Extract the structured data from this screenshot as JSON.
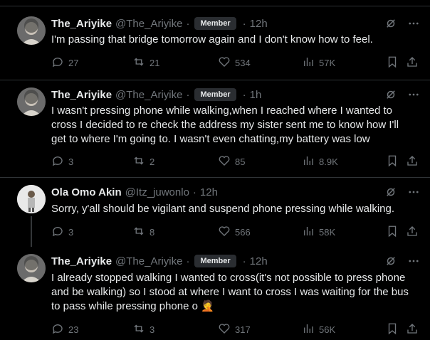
{
  "posts": [
    {
      "name": "The_Ariyike",
      "handle": "@The_Ariyike",
      "badge": "Member",
      "time": "12h",
      "lines": [
        "I'm passing that bridge tomorrow again and I don't know how to feel."
      ],
      "replies": "27",
      "reposts": "21",
      "likes": "534",
      "views": "57K"
    },
    {
      "name": "The_Ariyike",
      "handle": "@The_Ariyike",
      "badge": "Member",
      "time": "1h",
      "lines": [
        "I wasn't pressing phone while walking,when I reached where I wanted to",
        "cross I decided to re check the address my sister sent me to know how I'll",
        "get to where I'm going to. I wasn't even chatting,my battery was low"
      ],
      "replies": "3",
      "reposts": "2",
      "likes": "85",
      "views": "8.9K"
    },
    {
      "name": "Ola Omo Akin",
      "handle": "@Itz_juwonlo",
      "badge": "",
      "time": "12h",
      "lines": [
        "Sorry, y'all should be vigilant and suspend phone pressing while walking."
      ],
      "replies": "3",
      "reposts": "8",
      "likes": "566",
      "views": "58K"
    },
    {
      "name": "The_Ariyike",
      "handle": "@The_Ariyike",
      "badge": "Member",
      "time": "12h",
      "lines": [
        "I already stopped walking I wanted to cross(it's not possible to press phone",
        "and be walking) so I stood at where I want to cross I was waiting for the bus",
        "to pass while pressing phone o 🤦"
      ],
      "replies": "23",
      "reposts": "3",
      "likes": "317",
      "views": "56K"
    }
  ],
  "separator": "·",
  "colors": {
    "background": "#000000",
    "text": "#e7e9ea",
    "muted": "#71767b",
    "border": "#2f3336"
  },
  "icons": [
    "reply-icon",
    "repost-icon",
    "like-icon",
    "views-icon",
    "bookmark-icon",
    "share-icon",
    "grok-icon",
    "more-icon"
  ]
}
